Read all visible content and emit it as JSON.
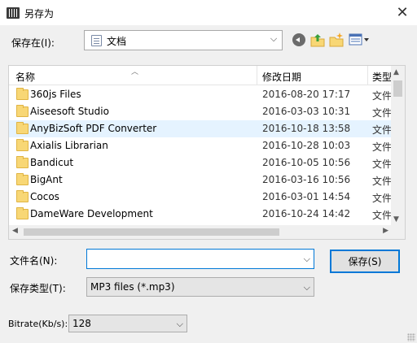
{
  "window": {
    "title": "另存为",
    "close_label": "✕"
  },
  "location": {
    "label": "保存在(I):",
    "value": "文档"
  },
  "toolbar": {
    "icons": [
      "back-icon",
      "up-folder-icon",
      "new-folder-icon",
      "view-menu-icon"
    ]
  },
  "listview": {
    "columns": [
      "名称",
      "修改日期",
      "类型"
    ],
    "rows": [
      {
        "name": "360js Files",
        "date": "2016-08-20 17:17",
        "type": "文件"
      },
      {
        "name": "Aiseesoft Studio",
        "date": "2016-03-03 10:31",
        "type": "文件"
      },
      {
        "name": "AnyBizSoft PDF Converter",
        "date": "2016-10-18 13:58",
        "type": "文件"
      },
      {
        "name": "Axialis Librarian",
        "date": "2016-10-28 10:03",
        "type": "文件"
      },
      {
        "name": "Bandicut",
        "date": "2016-10-05 10:56",
        "type": "文件"
      },
      {
        "name": "BigAnt",
        "date": "2016-03-16 10:56",
        "type": "文件"
      },
      {
        "name": "Cocos",
        "date": "2016-03-01 14:54",
        "type": "文件"
      },
      {
        "name": "DameWare Development",
        "date": "2016-10-24 14:42",
        "type": "文件"
      }
    ],
    "selected_row": "AnyBizSoft PDF Converter"
  },
  "form": {
    "filename_label": "文件名(N):",
    "filename_value": "",
    "filetype_label": "保存类型(T):",
    "filetype_value": "MP3 files (*.mp3)",
    "save_label": "保存(S)",
    "bitrate_label": "Bitrate(Kb/s):",
    "bitrate_value": "128"
  },
  "colors": {
    "accent": "#0078d7",
    "selection": "#e5f3ff",
    "folder": "#f8d775"
  }
}
